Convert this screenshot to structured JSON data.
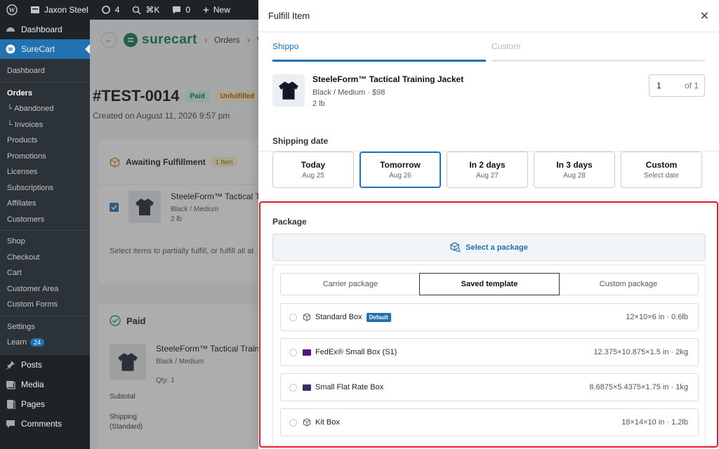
{
  "adminbar": {
    "site": "Jaxon Steel",
    "updates": "4",
    "shortcut": "⌘K",
    "comments": "0",
    "new": "New"
  },
  "sidebar": {
    "top": [
      {
        "label": "Dashboard"
      },
      {
        "label": "SureCart"
      }
    ],
    "sub": [
      "Dashboard",
      "Orders",
      "└ Abandoned",
      "└ Invoices",
      "Products",
      "Promotions",
      "Licenses",
      "Subscriptions",
      "Affiliates",
      "Customers",
      "Shop",
      "Checkout",
      "Cart",
      "Customer Area",
      "Custom Forms",
      "Settings",
      "Learn"
    ],
    "learn_badge": "24",
    "bottom": [
      {
        "label": "Posts"
      },
      {
        "label": "Media"
      },
      {
        "label": "Pages"
      },
      {
        "label": "Comments"
      }
    ]
  },
  "page": {
    "logo": "surecart",
    "crumb_orders": "Orders",
    "crumb_next": "V",
    "order_id": "#TEST-0014",
    "status_paid": "Paid",
    "status_unfulfilled": "Unfulfilled",
    "created": "Created on August 11, 2026 9:57 pm",
    "awaiting": "Awaiting Fulfillment",
    "awaiting_count": "1 Item",
    "item_name": "SteeleForm™ Tactical T",
    "item_variant": "Black / Medium",
    "item_weight": "2 lb",
    "select_hint": "Select items to partially fulfill, or fulfill all at",
    "paid_title": "Paid",
    "paid_item": "SteeleForm™ Tactical Trainin",
    "paid_variant": "Black / Medium",
    "qty": "Qty: 1",
    "subtotal": "Subtotal",
    "shipping": "Shipping",
    "shipping_method": "(Standard)"
  },
  "panel": {
    "title": "Fulfill Item",
    "tabs": [
      "Shippo",
      "Custom"
    ],
    "product": {
      "name": "SteeleForm™ Tactical Training Jacket",
      "variant": "Black / Medium",
      "price": "$98",
      "weight": "2 lb",
      "qty": "1",
      "qty_of": "of 1"
    },
    "shipping_date_label": "Shipping date",
    "dates": [
      {
        "main": "Today",
        "sub": "Aug 25"
      },
      {
        "main": "Tomorrow",
        "sub": "Aug 26"
      },
      {
        "main": "In 2 days",
        "sub": "Aug 27"
      },
      {
        "main": "In 3 days",
        "sub": "Aug 28"
      },
      {
        "main": "Custom",
        "sub": "Select date"
      }
    ],
    "package_label": "Package",
    "select_package": "Select a package",
    "seg_tabs": [
      "Carrier package",
      "Saved template",
      "Custom package"
    ],
    "templates": [
      {
        "name": "Standard Box",
        "tag": "Default",
        "dims": "12×10×6 in · 0.6lb",
        "icon": "box-icon"
      },
      {
        "name": "FedEx® Small Box (S1)",
        "tag": "",
        "dims": "12.375×10.875×1.5 in · 2kg",
        "icon": "fedex-icon"
      },
      {
        "name": "Small Flat Rate Box",
        "tag": "",
        "dims": "8.6875×5.4375×1.75 in · 1kg",
        "icon": "usps-icon"
      },
      {
        "name": "Kit Box",
        "tag": "",
        "dims": "18×14×10 in · 1.2lb",
        "icon": "box-icon"
      }
    ]
  },
  "colors": {
    "accent": "#2271b1",
    "highlight": "#e11d2a",
    "sidebar": "#1d2327"
  }
}
